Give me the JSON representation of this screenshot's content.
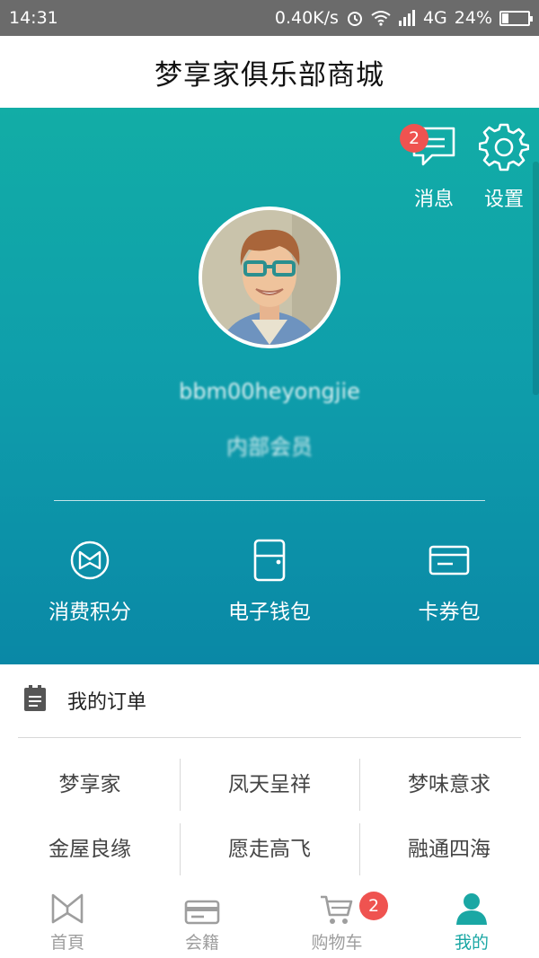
{
  "status_bar": {
    "time": "14:31",
    "speed": "0.40K/s",
    "network": "4G",
    "battery": "24%",
    "battery_level": 0.24
  },
  "header": {
    "title": "梦享家俱乐部商城"
  },
  "top_actions": {
    "messages_label": "消息",
    "messages_badge": "2",
    "settings_label": "设置"
  },
  "profile": {
    "username": "bbm00heyongjie",
    "member_level": "内部会员"
  },
  "quick_actions": [
    {
      "label": "消费积分",
      "icon": "points-icon"
    },
    {
      "label": "电子钱包",
      "icon": "wallet-icon"
    },
    {
      "label": "卡券包",
      "icon": "card-icon"
    }
  ],
  "orders": {
    "title": "我的订单",
    "brands": [
      [
        "梦享家",
        "凤天呈祥",
        "梦味意求"
      ],
      [
        "金屋良缘",
        "愿走高飞",
        "融通四海"
      ]
    ]
  },
  "tabs": [
    {
      "label": "首頁",
      "icon": "home-bow-icon"
    },
    {
      "label": "会籍",
      "icon": "membership-card-icon"
    },
    {
      "label": "购物车",
      "icon": "cart-icon",
      "badge": "2"
    },
    {
      "label": "我的",
      "icon": "user-icon",
      "active": true
    }
  ],
  "colors": {
    "accent": "#1aa7a4",
    "hero_top": "#12ada6",
    "hero_bottom": "#0a88a6",
    "badge": "#ef5350"
  }
}
